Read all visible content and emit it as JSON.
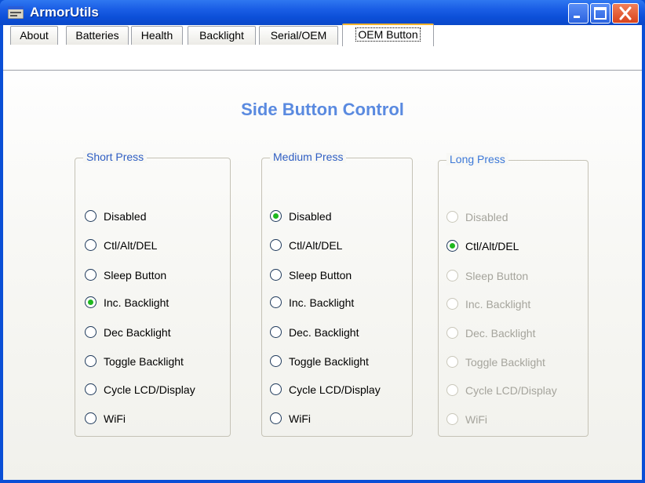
{
  "window": {
    "title": "ArmorUtils",
    "titlebar_color": "#0a4fd6"
  },
  "tabs": [
    {
      "label": "About",
      "active": false
    },
    {
      "label": "Batteries",
      "active": false
    },
    {
      "label": "Health",
      "active": false
    },
    {
      "label": "Backlight",
      "active": false
    },
    {
      "label": "Serial/OEM",
      "active": false
    },
    {
      "label": "OEM Button",
      "active": true
    }
  ],
  "page": {
    "heading": "Side Button Control",
    "accent_color": "#5a8ae0"
  },
  "groups": [
    {
      "legend": "Short Press",
      "enabled": true,
      "options": [
        "Disabled",
        "Ctl/Alt/DEL",
        "Sleep Button",
        "Inc. Backlight",
        "Dec Backlight",
        "Toggle Backlight",
        "Cycle LCD/Display",
        "WiFi"
      ],
      "selected": "Inc. Backlight"
    },
    {
      "legend": "Medium Press",
      "enabled": true,
      "options": [
        "Disabled",
        "Ctl/Alt/DEL",
        "Sleep Button",
        "Inc. Backlight",
        "Dec. Backlight",
        "Toggle Backlight",
        "Cycle LCD/Display",
        "WiFi"
      ],
      "selected": "Disabled"
    },
    {
      "legend": "Long Press",
      "enabled": false,
      "options": [
        "Disabled",
        "Ctl/Alt/DEL",
        "Sleep Button",
        "Inc. Backlight",
        "Dec. Backlight",
        "Toggle Backlight",
        "Cycle LCD/Display",
        "WiFi"
      ],
      "selected": "Ctl/Alt/DEL"
    }
  ],
  "icons": {
    "app": "app-window-icon",
    "minimize": "minimize-icon",
    "maximize": "maximize-icon",
    "close": "close-icon"
  }
}
